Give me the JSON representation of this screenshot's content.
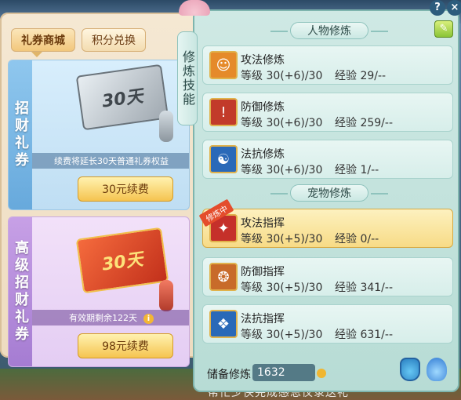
{
  "shop": {
    "tabs": [
      {
        "label": "礼券商城",
        "active": true
      },
      {
        "label": "积分兑换",
        "active": false
      }
    ],
    "cards": [
      {
        "side_title": "招财礼券",
        "ticket_text": "30天",
        "note": "续费将延长30天普通礼券权益",
        "button": "30元续费"
      },
      {
        "side_title": "高级招财礼券",
        "ticket_text": "30天",
        "note": "有效期剩余122天",
        "button": "98元续费"
      }
    ]
  },
  "vertical_tab": "修炼技能",
  "panel": {
    "sections": [
      {
        "title": "人物修炼",
        "skills": [
          {
            "name": "攻法修炼",
            "level": "等级  30(+6)/30",
            "exp": "经验  29/--",
            "icon": "attack-magic-icon",
            "color": "#e58a2a"
          },
          {
            "name": "防御修炼",
            "level": "等级  30(+6)/30",
            "exp": "经验  259/--",
            "icon": "defense-shield-icon",
            "color": "#c23a2a"
          },
          {
            "name": "法抗修炼",
            "level": "等级  30(+6)/30",
            "exp": "经验  1/--",
            "icon": "resist-taiji-icon",
            "color": "#2a69b8"
          }
        ]
      },
      {
        "title": "宠物修炼",
        "skills": [
          {
            "name": "攻法指挥",
            "level": "等级  30(+5)/30",
            "exp": "经验  0/--",
            "icon": "pet-attack-icon",
            "color": "#c5302a",
            "active": true,
            "ribbon": "修炼中"
          },
          {
            "name": "防御指挥",
            "level": "等级  30(+5)/30",
            "exp": "经验  341/--",
            "icon": "pet-defense-icon",
            "color": "#c86b2a"
          },
          {
            "name": "法抗指挥",
            "level": "等级  30(+5)/30",
            "exp": "经验  631/--",
            "icon": "pet-resist-icon",
            "color": "#2a69b8"
          }
        ]
      }
    ],
    "reserve_label": "储备修炼",
    "reserve_value": "1632"
  },
  "controls": {
    "help": "?",
    "close": "×"
  },
  "background_text": "帮忙少侠完成感恩仪录送礼"
}
